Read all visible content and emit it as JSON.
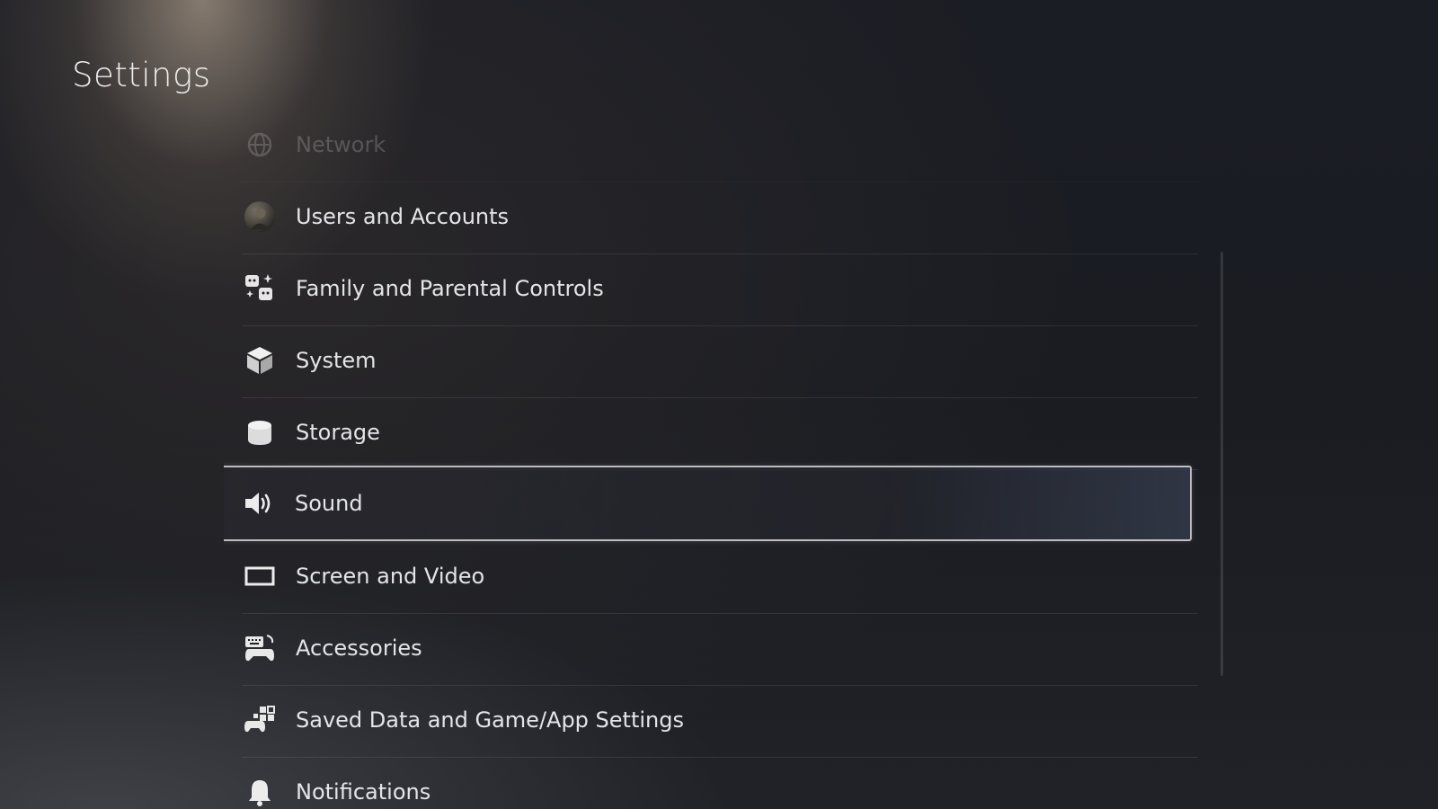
{
  "header": {
    "title": "Settings"
  },
  "settings_list": {
    "items": [
      {
        "label": "Network",
        "icon": "network-icon",
        "state": "faded"
      },
      {
        "label": "Users and Accounts",
        "icon": "user-avatar-icon"
      },
      {
        "label": "Family and Parental Controls",
        "icon": "family-icon"
      },
      {
        "label": "System",
        "icon": "cube-icon"
      },
      {
        "label": "Storage",
        "icon": "storage-icon"
      },
      {
        "label": "Sound",
        "icon": "speaker-icon",
        "state": "selected"
      },
      {
        "label": "Screen and Video",
        "icon": "screen-icon"
      },
      {
        "label": "Accessories",
        "icon": "accessories-icon"
      },
      {
        "label": "Saved Data and Game/App Settings",
        "icon": "saved-data-icon"
      },
      {
        "label": "Notifications",
        "icon": "bell-icon"
      }
    ]
  },
  "colors": {
    "background": "#1a1c22",
    "text": "#e4e5e8",
    "selection_border": "#d7d7dc"
  }
}
